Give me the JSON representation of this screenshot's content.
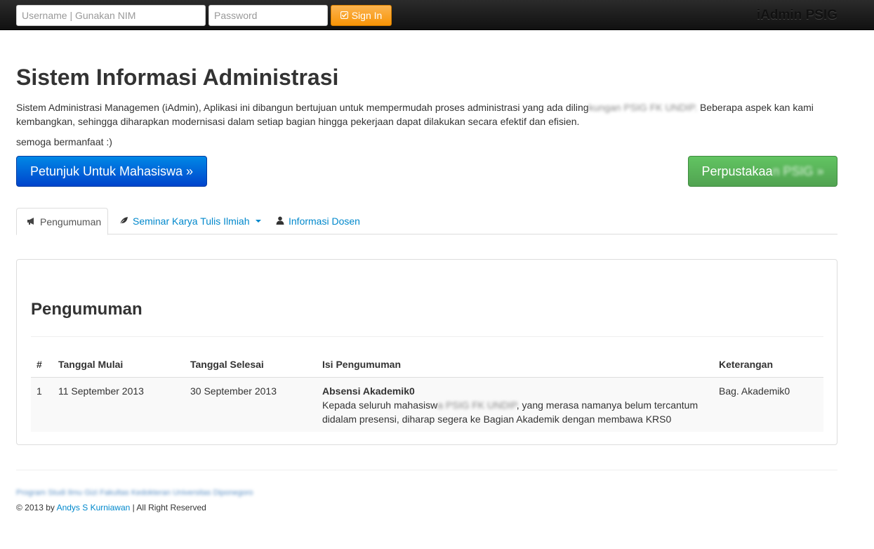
{
  "navbar": {
    "username_placeholder": "Username | Gunakan NIM",
    "password_placeholder": "Password",
    "signin_label": "Sign In",
    "brand": "iAdmin PSIG"
  },
  "hero": {
    "title": "Sistem Informasi Administrasi",
    "lead_part1": "Sistem Administrasi Managemen (iAdmin), Aplikasi ini dibangun bertujuan untuk mempermudah proses administrasi yang ada diling",
    "lead_blurred": "kungan PSIG FK UNDIP.",
    "lead_part2": " Beberapa aspek kan kami kembangkan, sehingga diharapkan modernisasi dalam setiap bagian hingga pekerjaan dapat dilakukan secara efektif dan efisien.",
    "small": "semoga bermanfaat :)",
    "btn_mahasiswa": "Petunjuk Untuk Mahasiswa »",
    "btn_perpus_visible": "Perpustakaa",
    "btn_perpus_blurred": "n PSIG »"
  },
  "tabs": [
    {
      "label": "Pengumuman",
      "icon": "megaphone-icon"
    },
    {
      "label": "Seminar Karya Tulis Ilmiah",
      "icon": "leaf-icon"
    },
    {
      "label": "Informasi Dosen",
      "icon": "user-icon"
    }
  ],
  "panel": {
    "title": "Pengumuman",
    "columns": [
      "#",
      "Tanggal Mulai",
      "Tanggal Selesai",
      "Isi Pengumuman",
      "Keterangan"
    ],
    "rows": [
      {
        "no": "1",
        "start": "11 September 2013",
        "end": "30 September 2013",
        "subject": "Absensi Akademik0",
        "body_part1": "Kepada seluruh mahasisw",
        "body_blurred": "a PSIG FK UNDIP",
        "body_part2": ", yang merasa namanya belum tercantum didalam presensi, diharap segera ke Bagian Akademik dengan membawa KRS0",
        "note": "Bag. Akademik0"
      }
    ]
  },
  "footer": {
    "institution_blurred": "Program Studi Ilmu Gizi Fakultas Kedokteran Universitas Diponegoro",
    "copyright_prefix": "© 2013 by ",
    "author": "Andys S Kurniawan",
    "copyright_suffix": " | All Right Reserved"
  }
}
